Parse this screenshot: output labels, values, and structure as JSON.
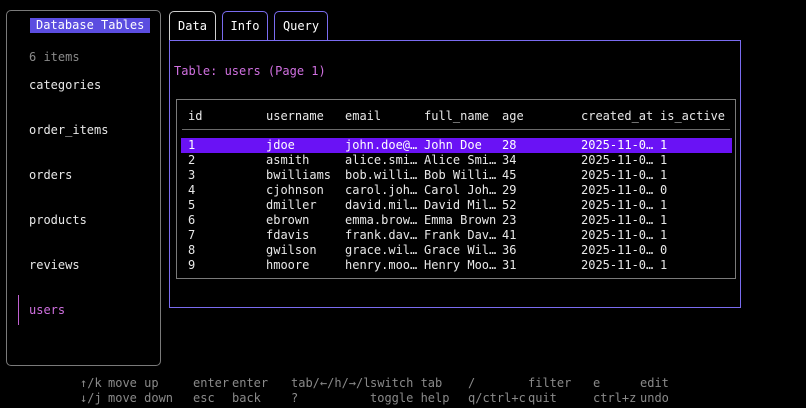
{
  "sidebar": {
    "title": "Database Tables",
    "count": "6 items",
    "items": [
      {
        "label": "categories"
      },
      {
        "label": "order_items"
      },
      {
        "label": "orders"
      },
      {
        "label": "products"
      },
      {
        "label": "reviews"
      },
      {
        "label": "users",
        "active": true
      }
    ]
  },
  "tabs": [
    {
      "label": "Data",
      "active": true
    },
    {
      "label": "Info"
    },
    {
      "label": "Query"
    }
  ],
  "table": {
    "title": "Table: users (Page 1)",
    "columns": [
      "id",
      "username",
      "email",
      "full_name",
      "age",
      "created_at",
      "is_active"
    ],
    "rows": [
      [
        "1",
        "jdoe",
        "john.doe@…",
        "John Doe",
        "28",
        "2025-11-0…",
        "1"
      ],
      [
        "2",
        "asmith",
        "alice.smi…",
        "Alice Smi…",
        "34",
        "2025-11-0…",
        "1"
      ],
      [
        "3",
        "bwilliams",
        "bob.willi…",
        "Bob Willi…",
        "45",
        "2025-11-0…",
        "1"
      ],
      [
        "4",
        "cjohnson",
        "carol.joh…",
        "Carol Joh…",
        "29",
        "2025-11-0…",
        "0"
      ],
      [
        "5",
        "dmiller",
        "david.mil…",
        "David Mil…",
        "52",
        "2025-11-0…",
        "1"
      ],
      [
        "6",
        "ebrown",
        "emma.brow…",
        "Emma Brown",
        "23",
        "2025-11-0…",
        "1"
      ],
      [
        "7",
        "fdavis",
        "frank.dav…",
        "Frank Dav…",
        "41",
        "2025-11-0…",
        "1"
      ],
      [
        "8",
        "gwilson",
        "grace.wil…",
        "Grace Wil…",
        "36",
        "2025-11-0…",
        "0"
      ],
      [
        "9",
        "hmoore",
        "henry.moo…",
        "Henry Moo…",
        "31",
        "2025-11-0…",
        "1"
      ]
    ],
    "selected_row": 0
  },
  "footer": [
    {
      "key": "↑/k",
      "desc": "move up"
    },
    {
      "key": "↓/j",
      "desc": "move down"
    },
    {
      "key": "enter",
      "desc": "enter"
    },
    {
      "key": "esc",
      "desc": "back"
    },
    {
      "key": "tab/←/h/→/l",
      "desc": "switch tab"
    },
    {
      "key": "?",
      "desc": "toggle help"
    },
    {
      "key": "/",
      "desc": "filter"
    },
    {
      "key": "q/ctrl+c",
      "desc": "quit"
    },
    {
      "key": "e",
      "desc": "edit"
    },
    {
      "key": "ctrl+z",
      "desc": "undo"
    }
  ],
  "colors": {
    "accent_purple": "#7a6cf0",
    "selection": "#6a12f5",
    "highlight_pink": "#d070e0",
    "sidebar_title_bg": "#5b4de0"
  }
}
